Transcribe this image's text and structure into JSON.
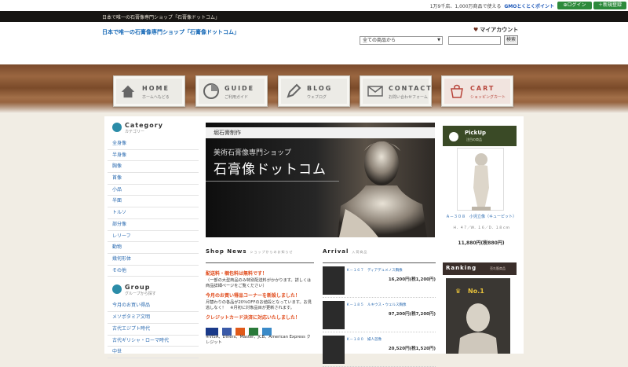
{
  "topbar": {
    "promo": "1万9千店、1,000万商品で使える",
    "gmo_logo": "GMOとくとくポイント",
    "login": "ログイン",
    "register": "新規登録"
  },
  "blackbar": {
    "text": "日本で唯一の石膏像専門ショップ「石膏像ドットコム」"
  },
  "header": {
    "title": "日本で唯一の石膏像専門ショップ「石膏像ドットコム」",
    "account": "マイアカウント",
    "select_value": "全ての商品から",
    "search_button": "検索"
  },
  "nav": [
    {
      "label": "HOME",
      "sub": "ホームへもどる",
      "icon": "home-icon"
    },
    {
      "label": "GUIDE",
      "sub": "ご利用ガイド",
      "icon": "guide-icon"
    },
    {
      "label": "BLOG",
      "sub": "ウェブログ",
      "icon": "pencil-icon"
    },
    {
      "label": "CONTACT",
      "sub": "お問い合わせフォーム",
      "icon": "mail-icon"
    },
    {
      "label": "CART",
      "sub": "ショッピングカート",
      "icon": "cart-icon"
    }
  ],
  "category": {
    "title": "Category",
    "sub": "カテゴリー",
    "items": [
      "全身像",
      "半身像",
      "胸像",
      "首像",
      "小品",
      "半面",
      "トルソ",
      "部分像",
      "レリーフ",
      "動物",
      "幾何形体",
      "その他"
    ]
  },
  "group": {
    "title": "Group",
    "sub": "グループから探す",
    "items": [
      "今月のお買い得品",
      "メソポタミア文明",
      "古代エジプト時代",
      "古代ギリシャ・ローマ時代",
      "中世"
    ]
  },
  "banner": {
    "top": "堀石膏制作",
    "mid": "美術石膏像専門ショップ",
    "big": "石膏像ドットコム"
  },
  "news": {
    "title": "Shop News",
    "sub": "ショップからのお知らせ",
    "p1_head": "配送料・梱包料は無料です！",
    "p1_body": "（一部の大型商品のみ特別配送料がかかります。詳しくは商品詳細ページをご覧ください）",
    "p2_head": "今月のお買い得品コーナーを新設しました！",
    "p2_body": "月替わりの各品が20％OFFのお値段となっています。お見逃しなく！　※月初に対象品目が更新されます。",
    "p3_head": "クレジットカード決済に対応いたしました！",
    "p3_body": "※VISA、Diners、Master、JCB、American Express クレジット"
  },
  "arrival": {
    "title": "Arrival",
    "sub": "入荷商品",
    "items": [
      {
        "name": "Ｋ－１６７　ディアデュメノス胸像",
        "price": "16,200円(税1,200円)"
      },
      {
        "name": "Ｋ－１８５　ルキウス・ウェルス胸像",
        "price": "97,200円(税7,200円)"
      },
      {
        "name": "Ｋ－１８０　婦人首像",
        "price": "20,520円(税1,520円)"
      }
    ]
  },
  "pickup": {
    "title": "PickUp",
    "sub": "注目の商品",
    "name": "Ａ－３０８　小児立像（キューピット）",
    "size": "Ｈ．４７／Ｗ．１６／Ｄ．１８ｃｍ",
    "price": "11,880円(税880円)"
  },
  "ranking": {
    "title": "Ranking",
    "sub": "売れ筋商品",
    "no": "No.1"
  }
}
